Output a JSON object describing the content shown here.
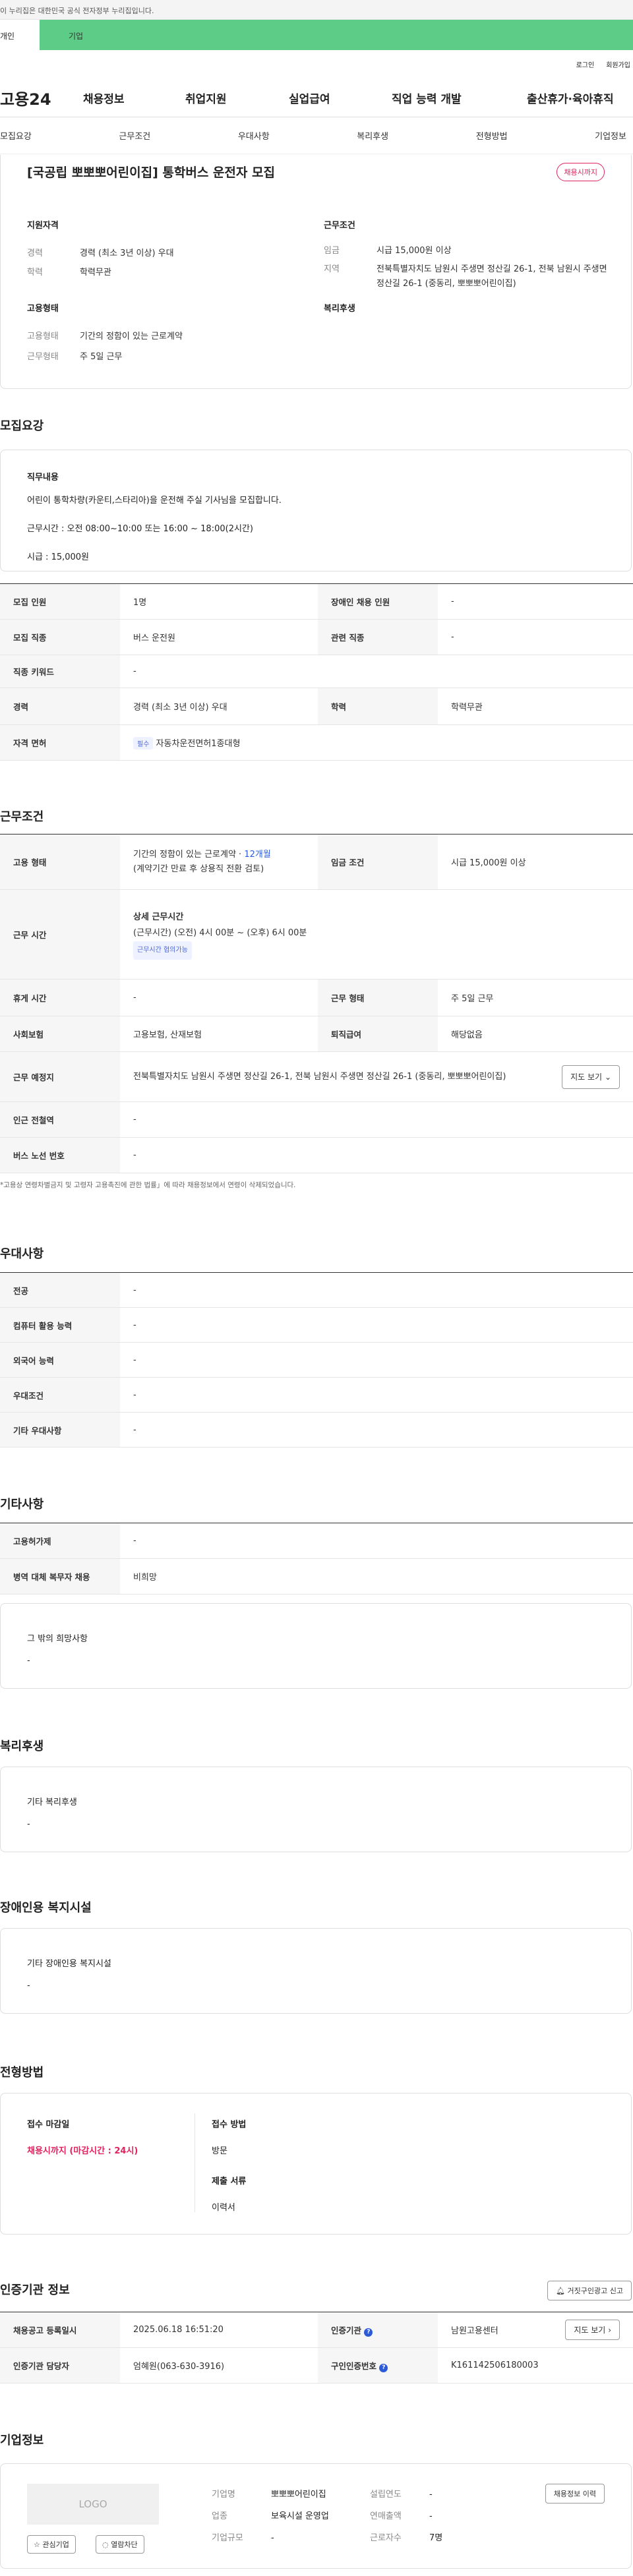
{
  "gov_banner": "이 누리집은 대한민국 공식 전자정부 누리집입니다.",
  "user_tabs": [
    "개인",
    "기업"
  ],
  "util_links": [
    "로그인",
    "회원가입"
  ],
  "gnb": {
    "logo": "고용24",
    "menu": [
      "채용정보",
      "취업지원",
      "실업급여",
      "직업 능력 개발",
      "출산휴가·육아휴직"
    ]
  },
  "lnb": [
    "모집요강",
    "근무조건",
    "우대사항",
    "복리후생",
    "전형방법",
    "기업정보"
  ],
  "job": {
    "title": "[국공립 뽀뽀뽀어린이집] 통학버스 운전자 모집",
    "badge": "채용시까지",
    "qual_title": "지원자격",
    "qual": [
      {
        "k": "경력",
        "v": "경력 (최소 3년 이상) 우대"
      },
      {
        "k": "학력",
        "v": "학력무관"
      }
    ],
    "cond_title": "근무조건",
    "cond": [
      {
        "k": "임금",
        "v": "시급 15,000원 이상"
      },
      {
        "k": "지역",
        "v": "전북특별자치도 남원시 주생면 정산길 26-1, 전북 남원시 주생면 정산길 26-1 (중동리, 뽀뽀뽀어린이집)"
      }
    ],
    "emp_title": "고용형태",
    "emp": [
      {
        "k": "고용형태",
        "v": "기간의 정함이 있는 근로계약"
      },
      {
        "k": "근무형태",
        "v": "주 5일 근무"
      }
    ],
    "wel_title": "복리후생"
  },
  "recruit": {
    "title": "모집요강",
    "duty_title": "직무내용",
    "duty": [
      "어린이 통학차량(카운티,스타리아)을 운전해 주실 기사님을 모집합니다.",
      "근무시간 : 오전 08:00~10:00 또는 16:00 ~ 18:00(2시간)",
      "시급 : 15,000원"
    ],
    "rows": [
      {
        "k": "모집 인원",
        "v": "1명",
        "k2": "장애인 채용 인원",
        "v2": "-"
      },
      {
        "k": "모집 직종",
        "v": "버스 운전원",
        "k2": "관련 직종",
        "v2": "-"
      },
      {
        "k": "직종 키워드",
        "v": "-"
      },
      {
        "k": "경력",
        "v": "경력 (최소 3년 이상) 우대",
        "k2": "학력",
        "v2": "학력무관"
      }
    ],
    "license_label": "자격 면허",
    "license_tag": "필수",
    "license": "자동차운전면허1종대형"
  },
  "work": {
    "title": "근무조건",
    "emp_k": "고용 형태",
    "emp_v": "기간의 정함이 있는 근로계약 · ",
    "emp_months": "12개월",
    "emp_note": "(계약기간 만료 후 상용직 전환 검토)",
    "wage_k": "임금 조건",
    "wage_v": "시급 15,000원 이상",
    "time_k": "근무 시간",
    "time_head": "상세 근무시간",
    "time_v": "(근무시간) (오전) 4시 00분 ~ (오후) 6시 00분",
    "time_tag": "근무시간 협의가능",
    "rest_k": "휴게 시간",
    "rest_v": "-",
    "type_k": "근무 형태",
    "type_v": "주 5일 근무",
    "ins_k": "사회보험",
    "ins_v": "고용보험, 산재보험",
    "ret_k": "퇴직급여",
    "ret_v": "해당없음",
    "loc_k": "근무 예정지",
    "loc_v": "전북특별자치도 남원시 주생면 정산길 26-1, 전북 남원시 주생면 정산길 26-1 (중동리, 뽀뽀뽀어린이집)",
    "map_btn": "지도 보기",
    "sub_k": "인근 전철역",
    "sub_v": "-",
    "bus_k": "버스 노선 번호",
    "bus_v": "-",
    "note": "*고용상 연령차별금지 및 고령자 고용촉진에 관한 법률」에 따라 채용정보에서 연령이 삭제되었습니다."
  },
  "pref": {
    "title": "우대사항",
    "rows": [
      {
        "k": "전공",
        "v": "-"
      },
      {
        "k": "컴퓨터 활용 능력",
        "v": "-"
      },
      {
        "k": "외국어 능력",
        "v": "-"
      },
      {
        "k": "우대조건",
        "v": "-"
      },
      {
        "k": "기타 우대사항",
        "v": "-"
      }
    ]
  },
  "etc": {
    "title": "기타사항",
    "rows": [
      {
        "k": "고용허가제",
        "v": "-"
      },
      {
        "k": "병역 대체 복무자 채용",
        "v": "비희망"
      }
    ],
    "other_title": "그 밖의 희망사항",
    "other_v": "-"
  },
  "welfare": {
    "title": "복리후생",
    "box_title": "기타 복리후생",
    "box_v": "-"
  },
  "disab": {
    "title": "장애인용 복지시설",
    "box_title": "기타 장애인용 복지시설",
    "box_v": "-"
  },
  "selection": {
    "title": "전형방법",
    "deadline_k": "접수 마감일",
    "deadline_v": "채용시까지 (마감시간 : 24시)",
    "method_k": "접수 방법",
    "method_v": "방문",
    "docs_k": "제출 서류",
    "docs_v": "이력서"
  },
  "agency": {
    "title": "인증기관 정보",
    "report_btn": "거짓구인광고 신고",
    "r1k": "채용공고 등록일시",
    "r1v": "2025.06.18 16:51:20",
    "r1k2": "인증기관",
    "r1v2": "남원고용센터",
    "map_btn": "지도 보기",
    "r2k": "인증기관 담당자",
    "r2v": "엄혜원(063-630-3916)",
    "r2k2": "구인인증번호",
    "r2v2": "K161142506180003"
  },
  "company": {
    "title": "기업정보",
    "logo": "LOGO",
    "fav": "관심기업",
    "block": "열람차단",
    "name_k": "기업명",
    "name_v": "뽀뽀뽀어린이집",
    "ind_k": "업종",
    "ind_v": "보육시설 운영업",
    "size_k": "기업규모",
    "size_v": "-",
    "est_k": "설립연도",
    "est_v": "-",
    "sales_k": "연매출액",
    "sales_v": "-",
    "emp_k": "근로자수",
    "emp_v": "7명",
    "history_btn": "채용정보 이력"
  }
}
